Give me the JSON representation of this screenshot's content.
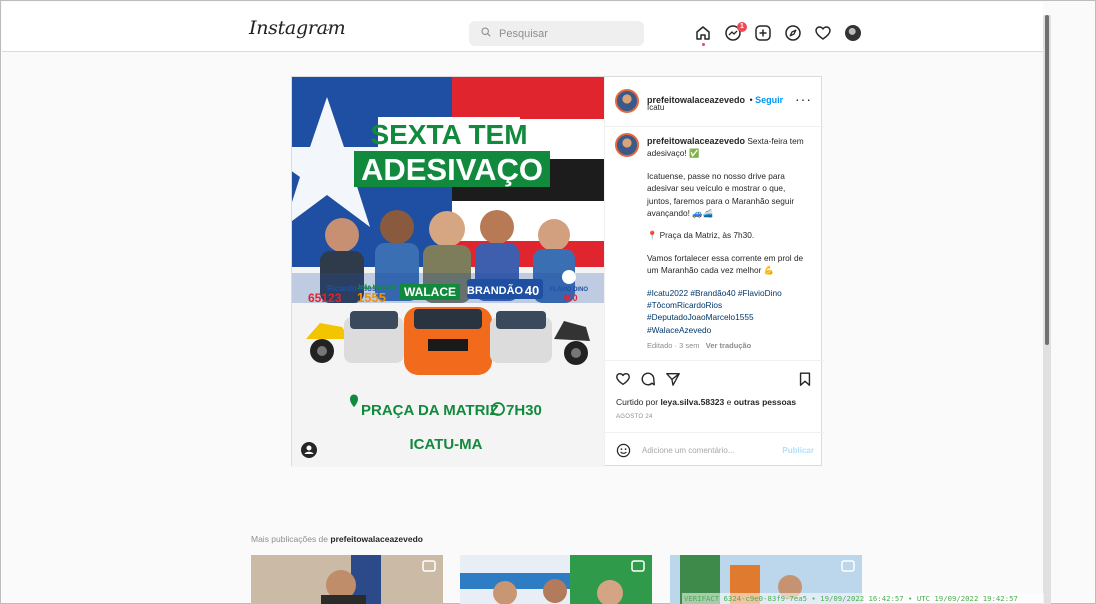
{
  "topbar": {
    "logo": "Instagram",
    "search_placeholder": "Pesquisar",
    "notification_count": "1"
  },
  "post": {
    "author": "prefeitowalaceazevedo",
    "follow_label": "Seguir",
    "location": "Icatu",
    "image": {
      "headline_top": "SEXTA TEM",
      "headline_bottom": "ADESIVAÇO",
      "candidates": [
        {
          "name": "Ricardo Rios",
          "number": "65123"
        },
        {
          "name": "João Marcelo",
          "number": "1555"
        },
        {
          "name": "WALACE",
          "number": ""
        },
        {
          "name": "BRANDÃO",
          "number": "40"
        },
        {
          "name": "FLAVIO DINO",
          "number": "400"
        }
      ],
      "place": "PRAÇA DA MATRIZ",
      "time": "7H30",
      "city": "ICATU-MA"
    },
    "caption": {
      "author": "prefeitowalaceazevedo",
      "p1": "Sexta-feira tem adesivaço! ✅",
      "p2": "Icatuense, passe no nosso drive para adesivar seu veículo e mostrar o que, juntos, faremos para o Maranhão seguir avançando! 🚙🚄",
      "p3": "📍 Praça da Matriz, às 7h30.",
      "p4": "Vamos fortalecer essa corrente em prol de um Maranhão cada vez melhor 💪",
      "hashtags": "#Icatu2022 #Brandão40 #FlavioDino #TôcomRicardoRios #DeputadoJoaoMarcelo1555 #WalaceAzevedo",
      "edited": "Editado · 3 sem",
      "translate": "Ver tradução"
    },
    "likes_prefix": "Curtido por",
    "likes_user": "leya.silva.58323",
    "likes_joiner": "e",
    "likes_others": "outras pessoas",
    "date": "AGOSTO 24",
    "comment_placeholder": "Adicione um comentário...",
    "publish_label": "Publicar"
  },
  "more_posts": {
    "title_prefix": "Mais publicações de",
    "title_user": "prefeitowalaceazevedo"
  },
  "watermark": "VERIFACT 6324-c9e0-83f9-7ea5 • 19/09/2022 16:42:57 • UTC 19/09/2022 19:42:57",
  "colors": {
    "accent": "#0095f6",
    "badge": "#ed4956",
    "poster_green": "#128a3d",
    "flag_red": "#e1252f",
    "flag_blue": "#1f4fa3"
  }
}
